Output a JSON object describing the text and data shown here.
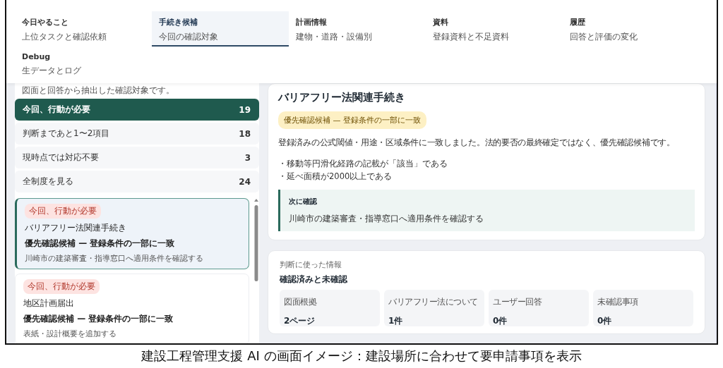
{
  "tabs": [
    {
      "label": "今日やること",
      "sub": "上位タスクと確認依頼",
      "selected": false
    },
    {
      "label": "手続き候補",
      "sub": "今回の確認対象",
      "selected": true
    },
    {
      "label": "計画情報",
      "sub": "建物・道路・設備別",
      "selected": false
    },
    {
      "label": "資料",
      "sub": "登録資料と不足資料",
      "selected": false
    },
    {
      "label": "履歴",
      "sub": "回答と評価の変化",
      "selected": false
    },
    {
      "label": "Debug",
      "sub": "生データとログ",
      "selected": false
    }
  ],
  "sidebar": {
    "intro": "図面と回答から抽出した確認対象です。",
    "filters": [
      {
        "label": "今回、行動が必要",
        "count": "19",
        "selected": true
      },
      {
        "label": "判断まであと1〜2項目",
        "count": "18",
        "selected": false
      },
      {
        "label": "現時点では対応不要",
        "count": "3",
        "selected": false
      },
      {
        "label": "全制度を見る",
        "count": "24",
        "selected": false
      }
    ],
    "cards": [
      {
        "badge": "今回、行動が必要",
        "title": "バリアフリー法関連手続き",
        "status": "優先確認候補 — 登録条件の一部に一致",
        "note": "川崎市の建築審査・指導窓口へ適用条件を確認する",
        "selected": true
      },
      {
        "badge": "今回、行動が必要",
        "title": "地区計画届出",
        "status": "優先確認候補 — 登録条件の一部に一致",
        "note": "表紙・設計概要を追加する",
        "selected": false
      }
    ]
  },
  "detail": {
    "title": "バリアフリー法関連手続き",
    "badge": "優先確認候補 — 登録条件の一部に一致",
    "summary": "登録済みの公式閾値・用途・区域条件に一致しました。法的要否の最終確定ではなく、優先確認候補です。",
    "conditions": [
      "・移動等円滑化経路の記載が「該当」である",
      "・延べ面積が2000以上である"
    ],
    "next": {
      "heading": "次に確認",
      "text": "川崎市の建築審査・指導窓口へ適用条件を確認する"
    }
  },
  "info": {
    "eyebrow": "判断に使った情報",
    "heading": "確認済みと未確認",
    "stats": [
      {
        "label": "図面根拠",
        "value": "2ページ"
      },
      {
        "label": "バリアフリー法について",
        "value": "1件"
      },
      {
        "label": "ユーザー回答",
        "value": "0件"
      },
      {
        "label": "未確認事項",
        "value": "0件"
      }
    ]
  },
  "caption": "建設工程管理支援 AI の画面イメージ：建設場所に合わせて要申請事項を表示"
}
